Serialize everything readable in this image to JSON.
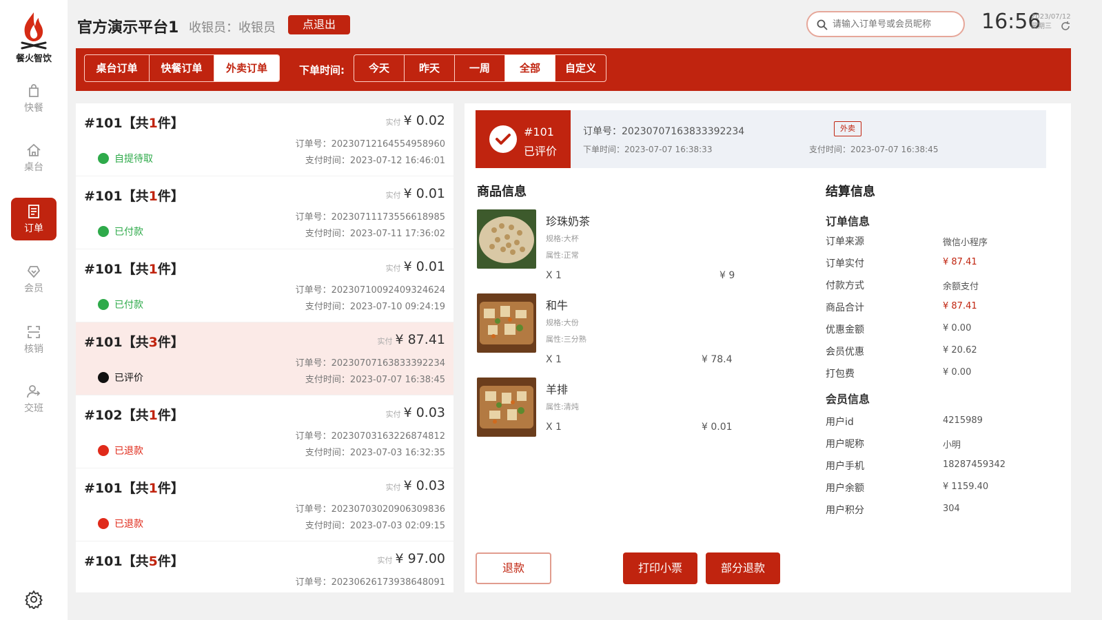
{
  "sidebar": {
    "logo_text": "餐火智饮",
    "items": [
      {
        "label": "快餐",
        "icon": "bag-icon",
        "active": false
      },
      {
        "label": "桌台",
        "icon": "home-icon",
        "active": false
      },
      {
        "label": "订单",
        "icon": "order-icon",
        "active": true
      },
      {
        "label": "会员",
        "icon": "vip-icon",
        "active": false
      },
      {
        "label": "核销",
        "icon": "scan-icon",
        "active": false
      },
      {
        "label": "交班",
        "icon": "handover-icon",
        "active": false
      }
    ]
  },
  "header": {
    "store_name": "官方演示平台1",
    "cashier": "收银员：收银员",
    "logout_label": "点退出",
    "search_placeholder": "请输入订单号或会员昵称",
    "time": "16:56",
    "date": "2023/07/12",
    "weekday": "星期三"
  },
  "filters": {
    "order_types": [
      "桌台订单",
      "快餐订单",
      "外卖订单"
    ],
    "selected_type": "外卖订单",
    "time_label": "下单时间:",
    "time_ranges": [
      "今天",
      "昨天",
      "一周",
      "全部",
      "自定义"
    ],
    "selected_range": "全部"
  },
  "orders": [
    {
      "title_prefix": "#101【共",
      "count": "1",
      "title_suffix": "件】",
      "price_prefix": "实付",
      "price": "¥ 0.02",
      "order_no": "订单号：20230712164554958960",
      "pay_time": "支付时间：2023-07-12 16:46:01",
      "status": "自提待取",
      "status_color": "#2eaa4a"
    },
    {
      "title_prefix": "#101【共",
      "count": "1",
      "title_suffix": "件】",
      "price_prefix": "实付",
      "price": "¥ 0.01",
      "order_no": "订单号：20230711173556618985",
      "pay_time": "支付时间：2023-07-11 17:36:02",
      "status": "已付款",
      "status_color": "#2eaa4a"
    },
    {
      "title_prefix": "#101【共",
      "count": "1",
      "title_suffix": "件】",
      "price_prefix": "实付",
      "price": "¥ 0.01",
      "order_no": "订单号：20230710092409324624",
      "pay_time": "支付时间：2023-07-10 09:24:19",
      "status": "已付款",
      "status_color": "#2eaa4a"
    },
    {
      "title_prefix": "#101【共",
      "count": "3",
      "title_suffix": "件】",
      "price_prefix": "实付",
      "price": "¥ 87.41",
      "order_no": "订单号：20230707163833392234",
      "pay_time": "支付时间：2023-07-07 16:38:45",
      "status": "已评价",
      "status_color": "#111111",
      "active": true
    },
    {
      "title_prefix": "#102【共",
      "count": "1",
      "title_suffix": "件】",
      "price_prefix": "实付",
      "price": "¥ 0.03",
      "order_no": "订单号：20230703163226874812",
      "pay_time": "支付时间：2023-07-03 16:32:35",
      "status": "已退款",
      "status_color": "#e02a1a"
    },
    {
      "title_prefix": "#101【共",
      "count": "1",
      "title_suffix": "件】",
      "price_prefix": "实付",
      "price": "¥ 0.03",
      "order_no": "订单号：20230703020906309836",
      "pay_time": "支付时间：2023-07-03 02:09:15",
      "status": "已退款",
      "status_color": "#e02a1a"
    },
    {
      "title_prefix": "#101【共",
      "count": "5",
      "title_suffix": "件】",
      "price_prefix": "实付",
      "price": "¥ 97.00",
      "order_no": "订单号：20230626173938648091",
      "pay_time": "",
      "status": "",
      "status_color": "#2eaa4a"
    }
  ],
  "detail": {
    "badge_no": "#101",
    "badge_status": "已评价",
    "order_no": "订单号：20230707163833392234",
    "order_time": "下单时间：2023-07-07 16:38:33",
    "tag": "外卖",
    "pay_time": "支付时间：2023-07-07 16:38:45",
    "goods_title": "商品信息",
    "goods": [
      {
        "name": "珍珠奶茶",
        "specs": [
          "规格:大杯",
          "属性:正常"
        ],
        "qty": "X 1",
        "price": "¥ 9",
        "img": "peanut"
      },
      {
        "name": "和牛",
        "specs": [
          "规格:大份",
          "属性:三分熟"
        ],
        "qty": "X 1",
        "price": "¥ 78.4",
        "img": "beef"
      },
      {
        "name": "羊排",
        "specs": [
          "属性:清炖"
        ],
        "qty": "X 1",
        "price": "¥ 0.01",
        "img": "lamb"
      }
    ],
    "settle_title": "结算信息",
    "order_info_title": "订单信息",
    "order_info": [
      {
        "label": "订单来源",
        "value": "微信小程序",
        "red": false
      },
      {
        "label": "订单实付",
        "value": "¥ 87.41",
        "red": true
      },
      {
        "label": "付款方式",
        "value": "余额支付",
        "red": false
      },
      {
        "label": "商品合计",
        "value": "¥ 87.41",
        "red": true
      },
      {
        "label": "优惠金额",
        "value": "¥ 0.00",
        "red": false
      },
      {
        "label": "会员优惠",
        "value": "¥ 20.62",
        "red": false
      },
      {
        "label": "打包费",
        "value": "¥ 0.00",
        "red": false
      }
    ],
    "member_info_title": "会员信息",
    "member_info": [
      {
        "label": "用户id",
        "value": "4215989"
      },
      {
        "label": "用户昵称",
        "value": "小明"
      },
      {
        "label": "用户手机",
        "value": "18287459342"
      },
      {
        "label": "用户余额",
        "value": "¥ 1159.40"
      },
      {
        "label": "用户积分",
        "value": "304"
      }
    ],
    "buttons": {
      "refund": "退款",
      "print": "打印小票",
      "partial_refund": "部分退款"
    }
  },
  "colors": {
    "brand": "#c0240f",
    "green": "#2eaa4a",
    "red": "#e02a1a"
  }
}
